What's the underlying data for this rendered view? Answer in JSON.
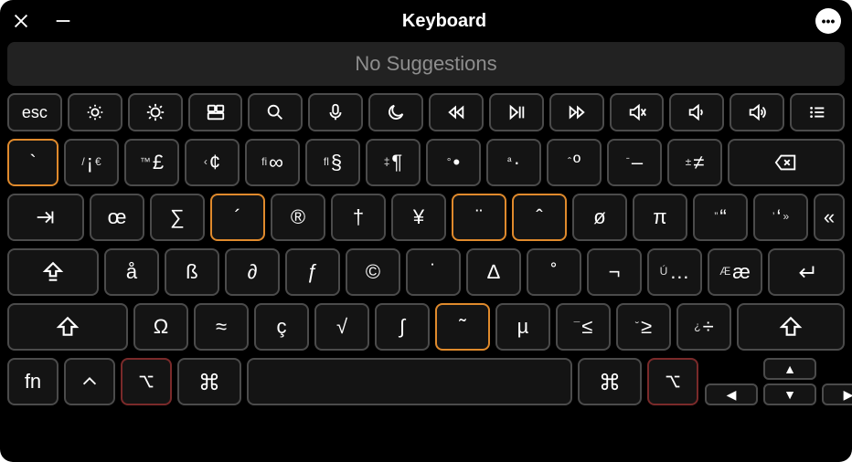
{
  "window": {
    "title": "Keyboard"
  },
  "suggestions": {
    "text": "No Suggestions"
  },
  "fnRow": {
    "esc": "esc"
  },
  "row1": {
    "k0": {
      "m": "`"
    },
    "k1": {
      "s": "/",
      "m": "¡",
      "s2": "€"
    },
    "k2": {
      "s": "™",
      "m": "£"
    },
    "k3": {
      "s": "‹",
      "m": "¢"
    },
    "k4": {
      "s": "fi",
      "m": "∞"
    },
    "k5": {
      "s": "fl",
      "m": "§"
    },
    "k6": {
      "s": "‡",
      "m": "¶"
    },
    "k7": {
      "s": "°",
      "m": "•"
    },
    "k8": {
      "s": "ª",
      "m": "·"
    },
    "k9": {
      "s": "ˆ",
      "m": "º"
    },
    "k10": {
      "s": "ˉ",
      "m": "–"
    },
    "k11": {
      "s": "±",
      "m": "≠"
    }
  },
  "row2": {
    "k0": {
      "m": "œ"
    },
    "k1": {
      "m": "∑"
    },
    "k2": {
      "m": "´"
    },
    "k3": {
      "m": "®"
    },
    "k4": {
      "m": "†"
    },
    "k5": {
      "m": "¥"
    },
    "k6": {
      "m": "¨"
    },
    "k7": {
      "m": "ˆ"
    },
    "k8": {
      "m": "ø"
    },
    "k9": {
      "m": "π"
    },
    "k10": {
      "s": "”",
      "m": "“"
    },
    "k11": {
      "s": "’",
      "m": "‘",
      "s2": "»"
    },
    "k12": {
      "m": "«"
    }
  },
  "row3": {
    "k0": {
      "m": "å"
    },
    "k1": {
      "m": "ß"
    },
    "k2": {
      "m": "∂"
    },
    "k3": {
      "m": "ƒ"
    },
    "k4": {
      "m": "©"
    },
    "k5": {
      "m": "˙"
    },
    "k6": {
      "m": "∆"
    },
    "k7": {
      "m": "˚"
    },
    "k8": {
      "m": "¬"
    },
    "k9": {
      "s": "Ú",
      "m": "…"
    },
    "k10": {
      "s": "Æ",
      "m": "æ"
    }
  },
  "row4": {
    "k0": {
      "m": "Ω"
    },
    "k1": {
      "m": "≈"
    },
    "k2": {
      "m": "ç"
    },
    "k3": {
      "m": "√"
    },
    "k4": {
      "m": "∫"
    },
    "k5": {
      "m": "˜"
    },
    "k6": {
      "m": "µ"
    },
    "k7": {
      "s": "¯",
      "m": "≤"
    },
    "k8": {
      "s": "˘",
      "m": "≥"
    },
    "k9": {
      "s": "¿",
      "m": "÷"
    }
  },
  "row5": {
    "fn": "fn"
  }
}
